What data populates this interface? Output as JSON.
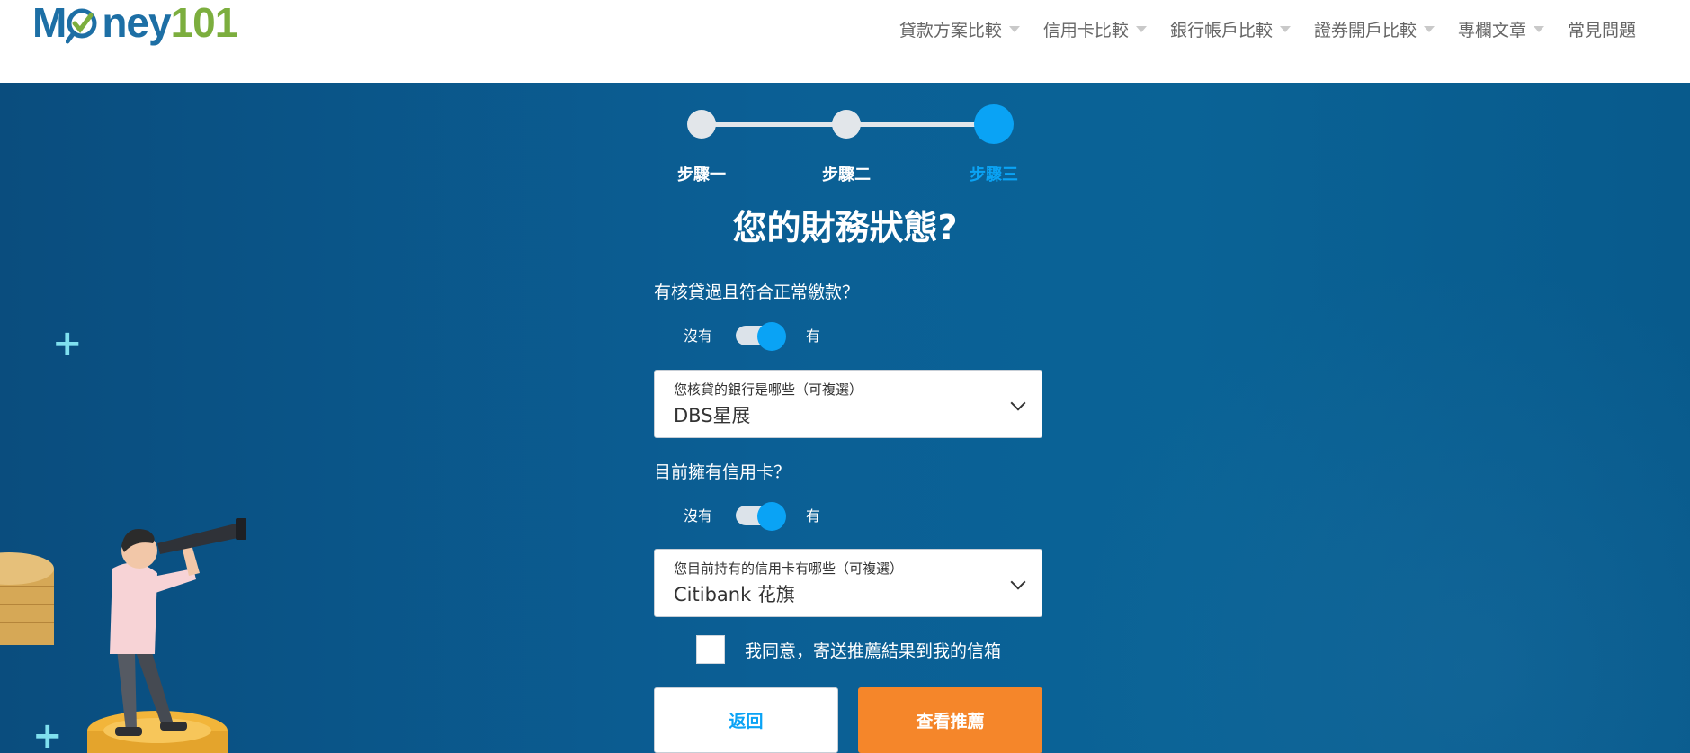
{
  "header": {
    "logo": {
      "prefix": "M",
      "suffix": "ney",
      "number": "101",
      "icon": "magnifier-check-icon"
    },
    "nav": [
      {
        "label": "貸款方案比較",
        "has_dropdown": true
      },
      {
        "label": "信用卡比較",
        "has_dropdown": true
      },
      {
        "label": "銀行帳戶比較",
        "has_dropdown": true
      },
      {
        "label": "證券開戶比較",
        "has_dropdown": true
      },
      {
        "label": "專欄文章",
        "has_dropdown": true
      },
      {
        "label": "常見問題",
        "has_dropdown": false
      }
    ]
  },
  "stepper": {
    "steps": [
      {
        "label": "步驟一",
        "active": false
      },
      {
        "label": "步驟二",
        "active": false
      },
      {
        "label": "步驟三",
        "active": true
      }
    ]
  },
  "form": {
    "title": "您的財務狀態?",
    "q1": {
      "label": "有核貸過且符合正常繳款？",
      "toggle_off": "沒有",
      "toggle_on": "有",
      "value": "on"
    },
    "bank_select": {
      "label": "您核貸的銀行是哪些（可複選）",
      "value": "DBS星展"
    },
    "q2": {
      "label": "目前擁有信用卡？",
      "toggle_off": "沒有",
      "toggle_on": "有",
      "value": "on"
    },
    "card_select": {
      "label": "您目前持有的信用卡有哪些（可複選）",
      "value": "Citibank 花旗"
    },
    "agree": {
      "label": "我同意，寄送推薦結果到我的信箱",
      "checked": false
    },
    "buttons": {
      "back": "返回",
      "next": "查看推薦"
    }
  },
  "colors": {
    "accent": "#0aa3f5",
    "cta": "#f5862a",
    "background": "#0a5a8a",
    "logo_blue": "#1d6fa5",
    "logo_green": "#7cae3e"
  }
}
